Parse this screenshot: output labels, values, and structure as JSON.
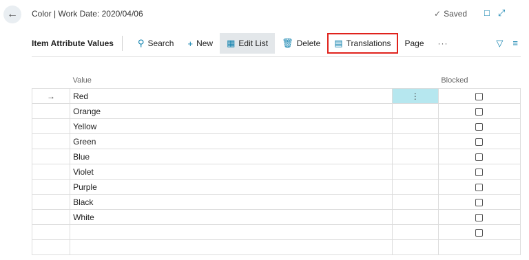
{
  "header": {
    "title": "Color | Work Date: 2020/04/06",
    "saved_label": "Saved"
  },
  "toolbar": {
    "page_caption": "Item Attribute Values",
    "search": "Search",
    "new": "New",
    "edit_list": "Edit List",
    "delete": "Delete",
    "translations": "Translations",
    "page": "Page",
    "more": "···"
  },
  "table": {
    "columns": [
      "Value",
      "Blocked"
    ],
    "current_row_marker": "→",
    "row_menu_glyph": "⋮",
    "rows": [
      {
        "value": "Red",
        "blocked": false
      },
      {
        "value": "Orange",
        "blocked": false
      },
      {
        "value": "Yellow",
        "blocked": false
      },
      {
        "value": "Green",
        "blocked": false
      },
      {
        "value": "Blue",
        "blocked": false
      },
      {
        "value": "Violet",
        "blocked": false
      },
      {
        "value": "Purple",
        "blocked": false
      },
      {
        "value": "Black",
        "blocked": false
      },
      {
        "value": "White",
        "blocked": false
      },
      {
        "value": "",
        "blocked": false
      },
      {
        "value": "",
        "blocked": null
      }
    ]
  },
  "colors": {
    "accent": "#0b7fad",
    "highlight_border": "#e0221c",
    "current_cell": "#b6e7ef"
  }
}
